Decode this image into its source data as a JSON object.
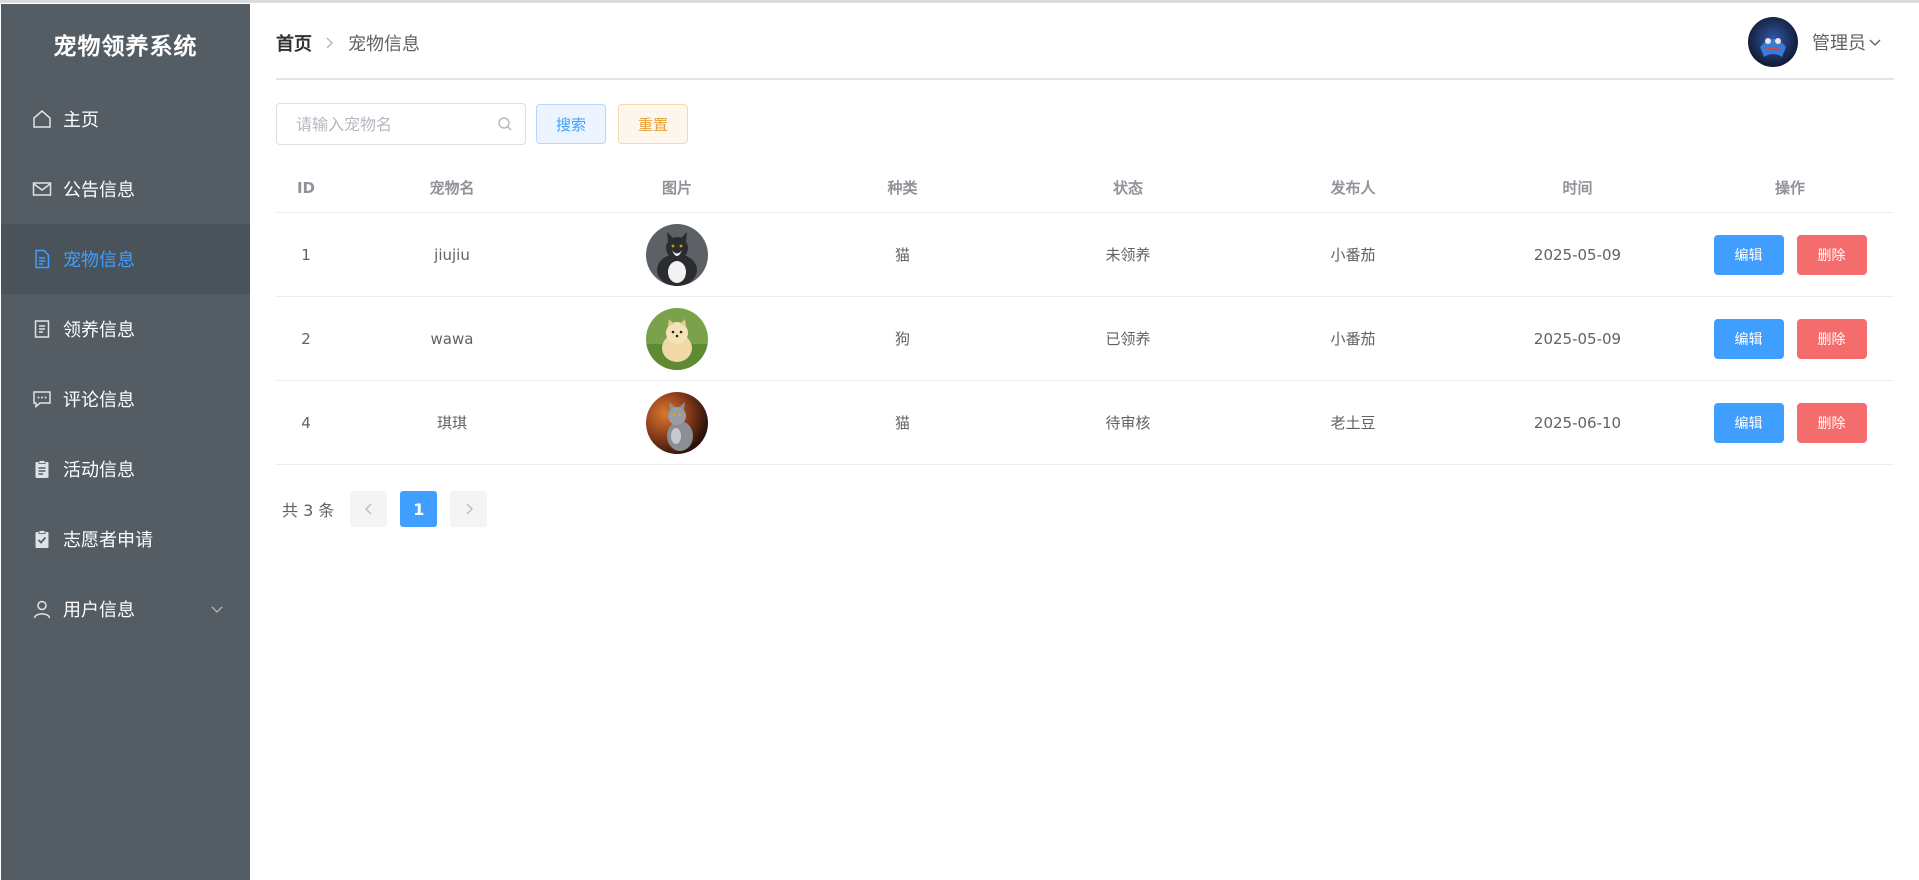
{
  "sidebar": {
    "title": "宠物领养系统",
    "items": [
      {
        "label": "主页",
        "icon": "home-icon"
      },
      {
        "label": "公告信息",
        "icon": "envelope-icon"
      },
      {
        "label": "宠物信息",
        "icon": "document-icon",
        "active": true
      },
      {
        "label": "领养信息",
        "icon": "notes-icon"
      },
      {
        "label": "评论信息",
        "icon": "comment-icon"
      },
      {
        "label": "活动信息",
        "icon": "clipboard-icon"
      },
      {
        "label": "志愿者申请",
        "icon": "clipboard-check-icon"
      },
      {
        "label": "用户信息",
        "icon": "user-icon",
        "submenu_icon": "chevron-down-icon"
      }
    ]
  },
  "header": {
    "breadcrumb": {
      "home": "首页",
      "current": "宠物信息"
    },
    "user": {
      "name": "管理员"
    }
  },
  "search": {
    "placeholder": "请输入宠物名",
    "value": "",
    "search_label": "搜索",
    "reset_label": "重置"
  },
  "table": {
    "columns": [
      "ID",
      "宠物名",
      "图片",
      "种类",
      "状态",
      "发布人",
      "时间",
      "操作"
    ],
    "rows": [
      {
        "id": "1",
        "name": "jiujiu",
        "type": "猫",
        "status": "未领养",
        "publisher": "小番茄",
        "time": "2025-05-09",
        "image": "black-white-cat-photo"
      },
      {
        "id": "2",
        "name": "wawa",
        "type": "狗",
        "status": "已领养",
        "publisher": "小番茄",
        "time": "2025-05-09",
        "image": "pomeranian-dog-photo"
      },
      {
        "id": "4",
        "name": "琪琪",
        "type": "猫",
        "status": "待审核",
        "publisher": "老土豆",
        "time": "2025-06-10",
        "image": "grey-cat-photo"
      }
    ],
    "edit_label": "编辑",
    "delete_label": "删除"
  },
  "pagination": {
    "total_text": "共 3 条",
    "current_page": "1"
  },
  "colors": {
    "sidebar_bg": "#545c64",
    "accent": "#409eff",
    "danger": "#f56c6c",
    "warning": "#e6a23c"
  }
}
